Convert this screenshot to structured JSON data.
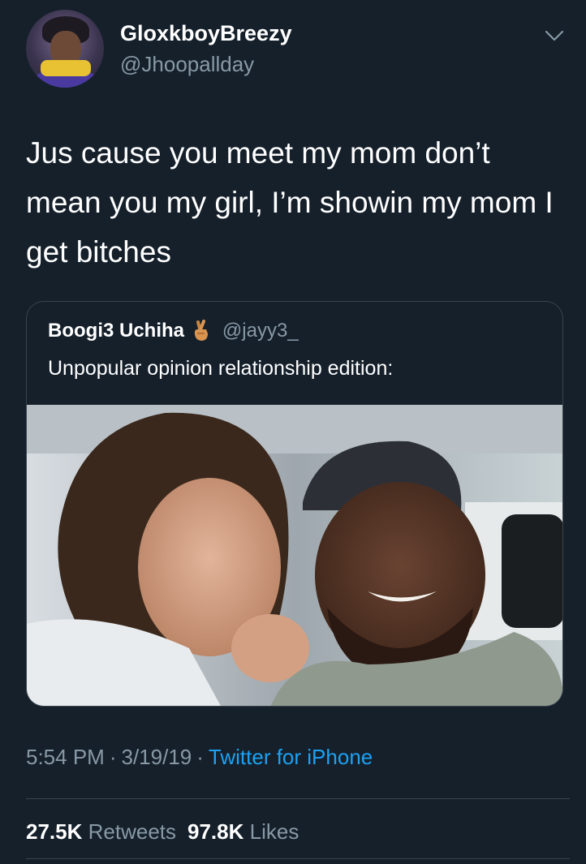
{
  "tweet": {
    "author_name": "GloxkboyBreezy",
    "author_handle": "@Jhoopallday",
    "text": "Jus cause you meet my mom don’t mean you my girl, I’m showin my mom I get bitches",
    "quoted": {
      "author_name": "Boogi3 Uchiha",
      "author_emoji": "crossed-fingers-emoji",
      "author_handle": "@jayy3_",
      "text": "Unpopular opinion relationship edition:"
    },
    "time": "5:54 PM",
    "date": "3/19/19",
    "source": "Twitter for iPhone",
    "separator": "·",
    "retweets_count": "27.5K",
    "retweets_label": "Retweets",
    "likes_count": "97.8K",
    "likes_label": "Likes"
  },
  "icons": {
    "more": "chevron-down-icon"
  },
  "colors": {
    "background": "#15202b",
    "border": "#38444d",
    "secondary_text": "#8899a6",
    "link": "#1da1f2"
  }
}
